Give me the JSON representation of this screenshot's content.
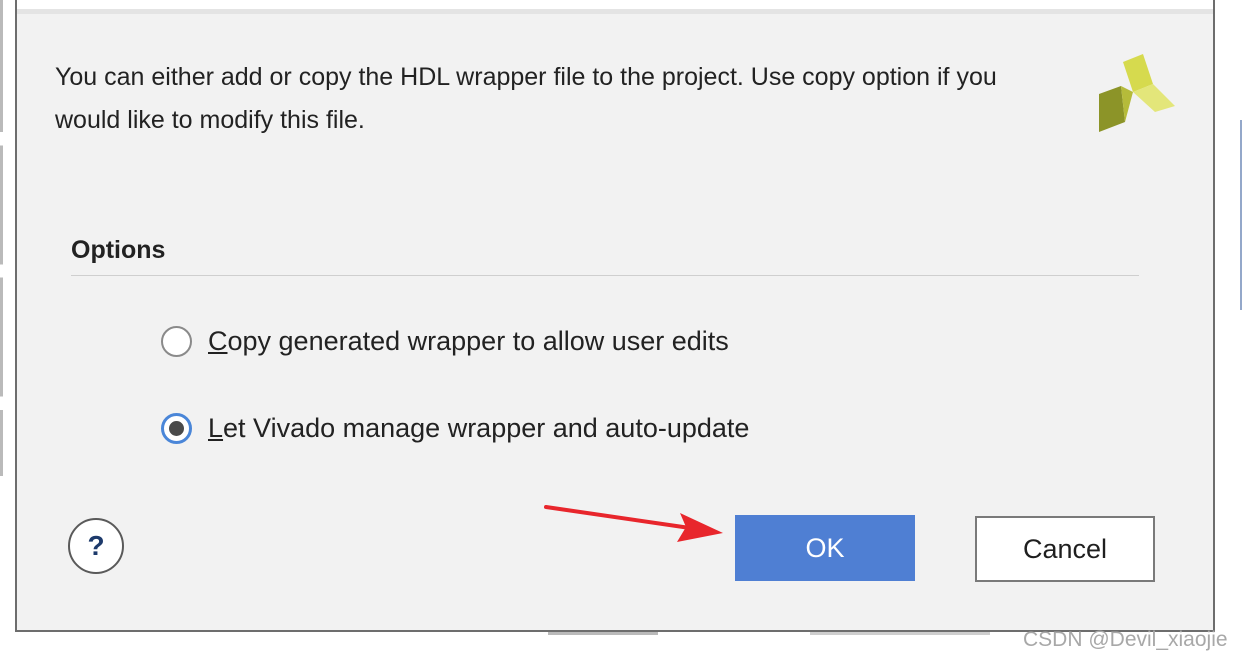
{
  "dialog": {
    "message": "You can either add or copy the HDL wrapper file to the project. Use copy option if you would like to modify this file.",
    "logo_icon": "vivado-logo-icon",
    "options_title": "Options",
    "options": [
      {
        "mnemonic": "C",
        "rest": "opy generated wrapper to allow user edits",
        "selected": false
      },
      {
        "mnemonic": "L",
        "rest": "et Vivado manage wrapper and auto-update",
        "selected": true
      }
    ],
    "help_label": "?",
    "ok_label": "OK",
    "cancel_label": "Cancel"
  },
  "annotation": {
    "arrow_icon": "red-arrow-icon",
    "arrow_color": "#e8262c"
  },
  "colors": {
    "ok_button": "#4f7fd3",
    "radio_accent": "#4a86d8",
    "dialog_background": "#f2f2f2",
    "logo_light": "#d8dc52",
    "logo_dark": "#8c9428"
  },
  "watermark": "CSDN @Devil_xiaojie"
}
